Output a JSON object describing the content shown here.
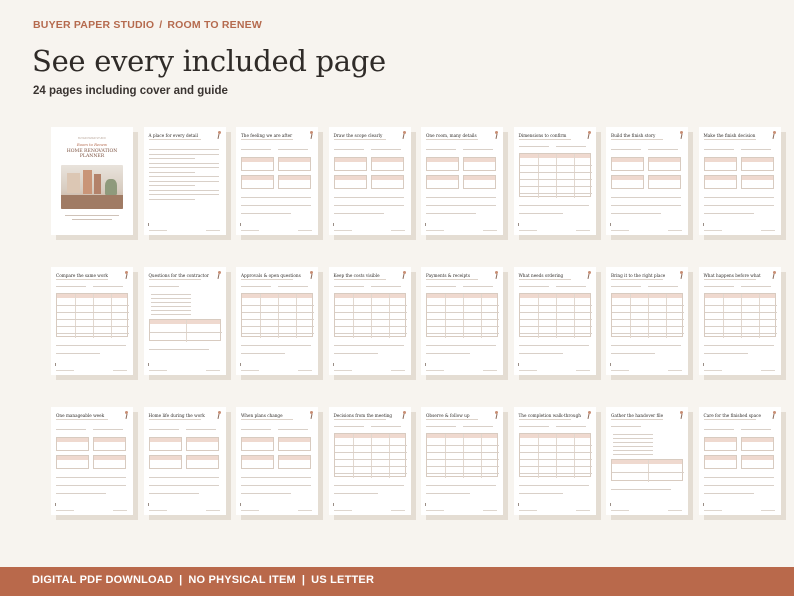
{
  "header": {
    "brand": "BUYER PAPER STUDIO",
    "separator": "/",
    "collection": "ROOM TO RENEW"
  },
  "title": "See every included page",
  "subtitle": "24 pages including cover and guide",
  "cover": {
    "brand": "BUYER PAPER STUDIO",
    "script_title": "Room to Renew",
    "title_line1": "HOME RENOVATION",
    "title_line2": "PLANNER"
  },
  "pages": [
    {
      "title": "A place for every detail",
      "layout": "text"
    },
    {
      "title": "The feeling we are after",
      "layout": "boxes"
    },
    {
      "title": "Draw the scope clearly",
      "layout": "boxes"
    },
    {
      "title": "One room, many details",
      "layout": "boxes"
    },
    {
      "title": "Dimensions to confirm",
      "layout": "table"
    },
    {
      "title": "Build the finish story",
      "layout": "boxes"
    },
    {
      "title": "Make the finish decision",
      "layout": "boxes"
    },
    {
      "title": "Compare the same work",
      "layout": "table"
    },
    {
      "title": "Questions for the contractor",
      "layout": "list"
    },
    {
      "title": "Approvals & open questions",
      "layout": "table"
    },
    {
      "title": "Keep the costs visible",
      "layout": "table"
    },
    {
      "title": "Payments & receipts",
      "layout": "table"
    },
    {
      "title": "What needs ordering",
      "layout": "table"
    },
    {
      "title": "Bring it to the right place",
      "layout": "table"
    },
    {
      "title": "What happens before what",
      "layout": "table"
    },
    {
      "title": "One manageable week",
      "layout": "boxes"
    },
    {
      "title": "Home life during the work",
      "layout": "boxes"
    },
    {
      "title": "When plans change",
      "layout": "boxes"
    },
    {
      "title": "Decisions from the meeting",
      "layout": "table"
    },
    {
      "title": "Observe & follow up",
      "layout": "table"
    },
    {
      "title": "The completion walk-through",
      "layout": "table"
    },
    {
      "title": "Gather the handover file",
      "layout": "list"
    },
    {
      "title": "Care for the finished space",
      "layout": "boxes"
    }
  ],
  "footer": {
    "item1": "DIGITAL PDF DOWNLOAD",
    "item2": "NO PHYSICAL ITEM",
    "item3": "US LETTER",
    "separator": "|"
  },
  "colors": {
    "accent": "#b56a4e",
    "band": "#b9694b",
    "background": "#f7f4ef"
  }
}
